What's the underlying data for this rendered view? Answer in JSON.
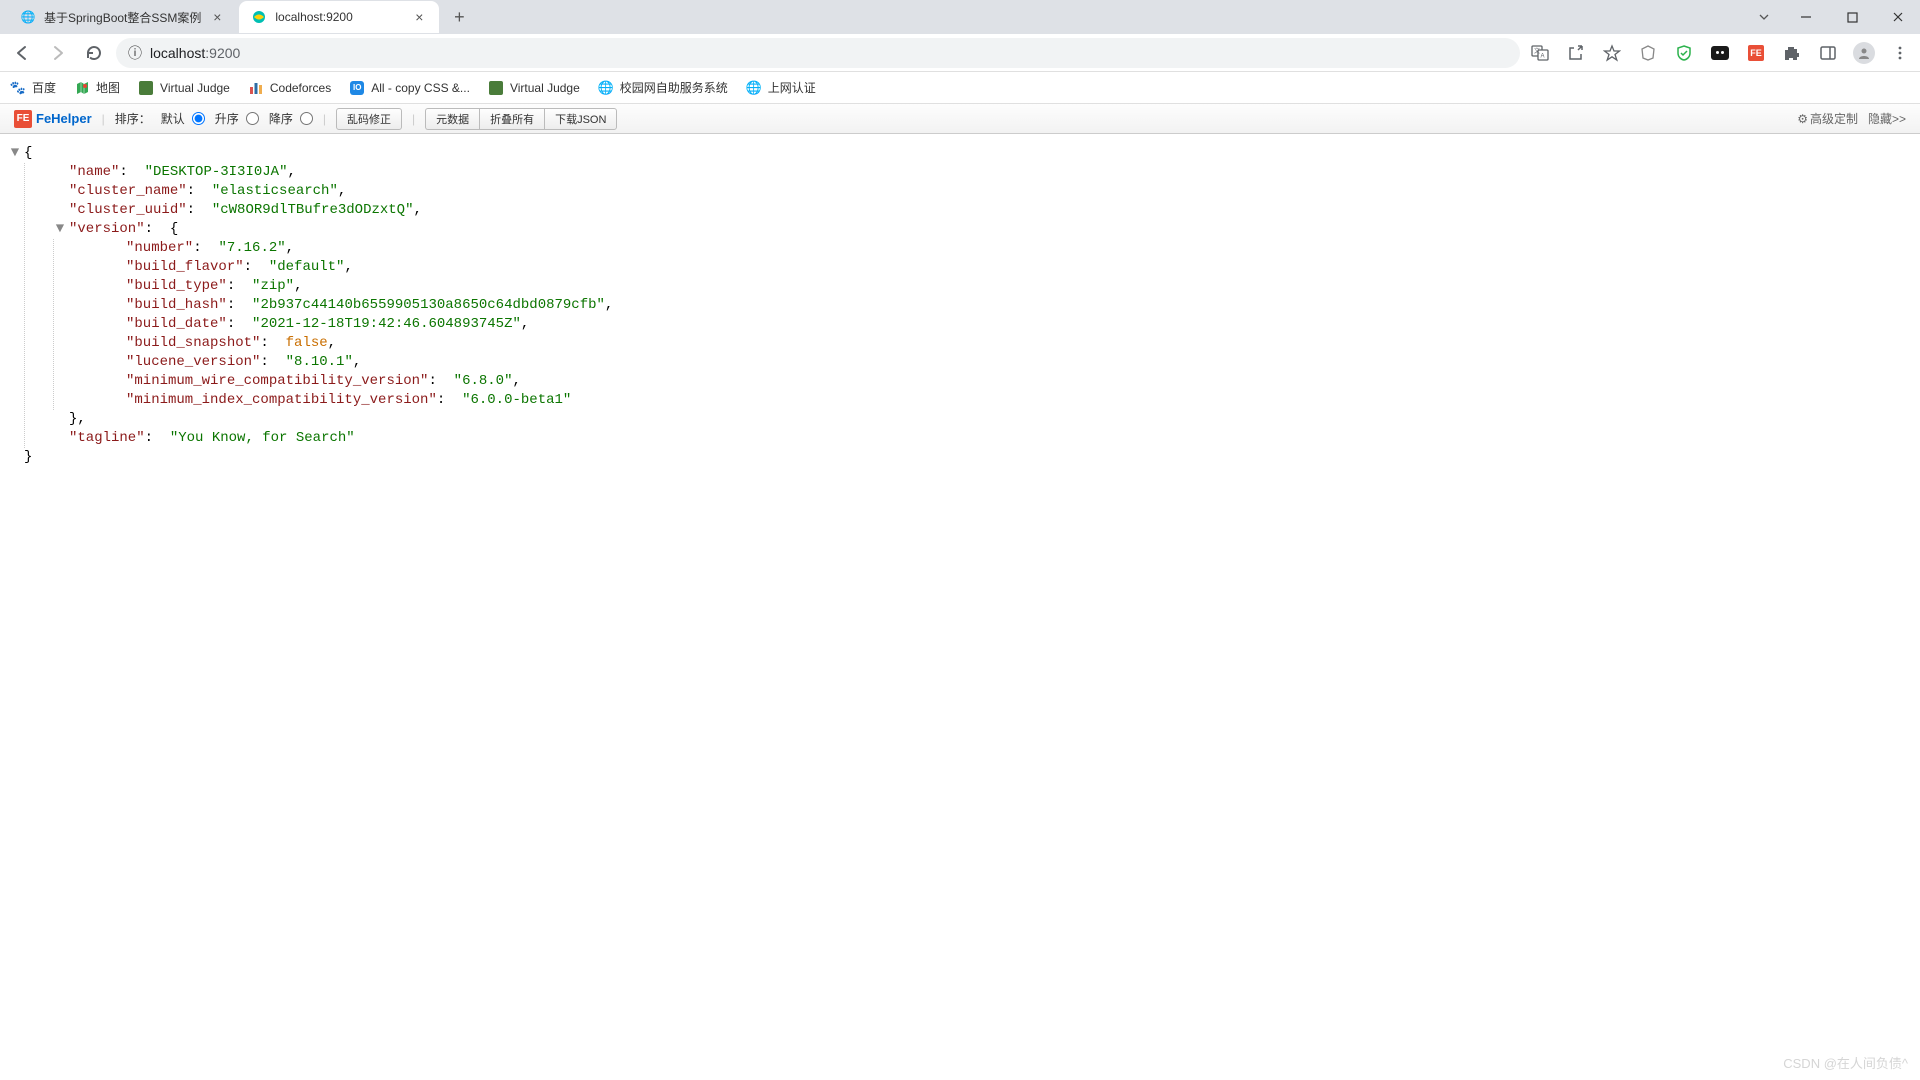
{
  "tabs": [
    {
      "title": "基于SpringBoot整合SSM案例",
      "active": false
    },
    {
      "title": "localhost:9200",
      "active": true
    }
  ],
  "address": {
    "info_icon": "ⓘ",
    "host": "localhost",
    "port": ":9200"
  },
  "bookmarks": [
    {
      "label": "百度"
    },
    {
      "label": "地图"
    },
    {
      "label": "Virtual Judge"
    },
    {
      "label": "Codeforces"
    },
    {
      "label": "All - copy CSS &..."
    },
    {
      "label": "Virtual Judge"
    },
    {
      "label": "校园网自助服务系统"
    },
    {
      "label": "上网认证"
    }
  ],
  "fehelper": {
    "logo": "FeHelper",
    "logo_badge": "FE",
    "sort_label": "排序：",
    "radio_default": "默认",
    "radio_asc": "升序",
    "radio_desc": "降序",
    "btn_encoding": "乱码修正",
    "btn_metadata": "元数据",
    "btn_collapse": "折叠所有",
    "btn_download": "下载JSON",
    "advanced": "高级定制",
    "hide": "隐藏>>"
  },
  "json": {
    "name": {
      "k": "\"name\"",
      "v": "\"DESKTOP-3I3I0JA\""
    },
    "cluster_name": {
      "k": "\"cluster_name\"",
      "v": "\"elasticsearch\""
    },
    "cluster_uuid": {
      "k": "\"cluster_uuid\"",
      "v": "\"cW8OR9dlTBufre3dODzxtQ\""
    },
    "version_key": "\"version\"",
    "version": {
      "number": {
        "k": "\"number\"",
        "v": "\"7.16.2\""
      },
      "build_flavor": {
        "k": "\"build_flavor\"",
        "v": "\"default\""
      },
      "build_type": {
        "k": "\"build_type\"",
        "v": "\"zip\""
      },
      "build_hash": {
        "k": "\"build_hash\"",
        "v": "\"2b937c44140b6559905130a8650c64dbd0879cfb\""
      },
      "build_date": {
        "k": "\"build_date\"",
        "v": "\"2021-12-18T19:42:46.604893745Z\""
      },
      "build_snapshot": {
        "k": "\"build_snapshot\"",
        "v": "false"
      },
      "lucene_version": {
        "k": "\"lucene_version\"",
        "v": "\"8.10.1\""
      },
      "min_wire": {
        "k": "\"minimum_wire_compatibility_version\"",
        "v": "\"6.8.0\""
      },
      "min_index": {
        "k": "\"minimum_index_compatibility_version\"",
        "v": "\"6.0.0-beta1\""
      }
    },
    "tagline": {
      "k": "\"tagline\"",
      "v": "\"You Know, for Search\""
    }
  },
  "watermark": "CSDN @在人间负债^"
}
